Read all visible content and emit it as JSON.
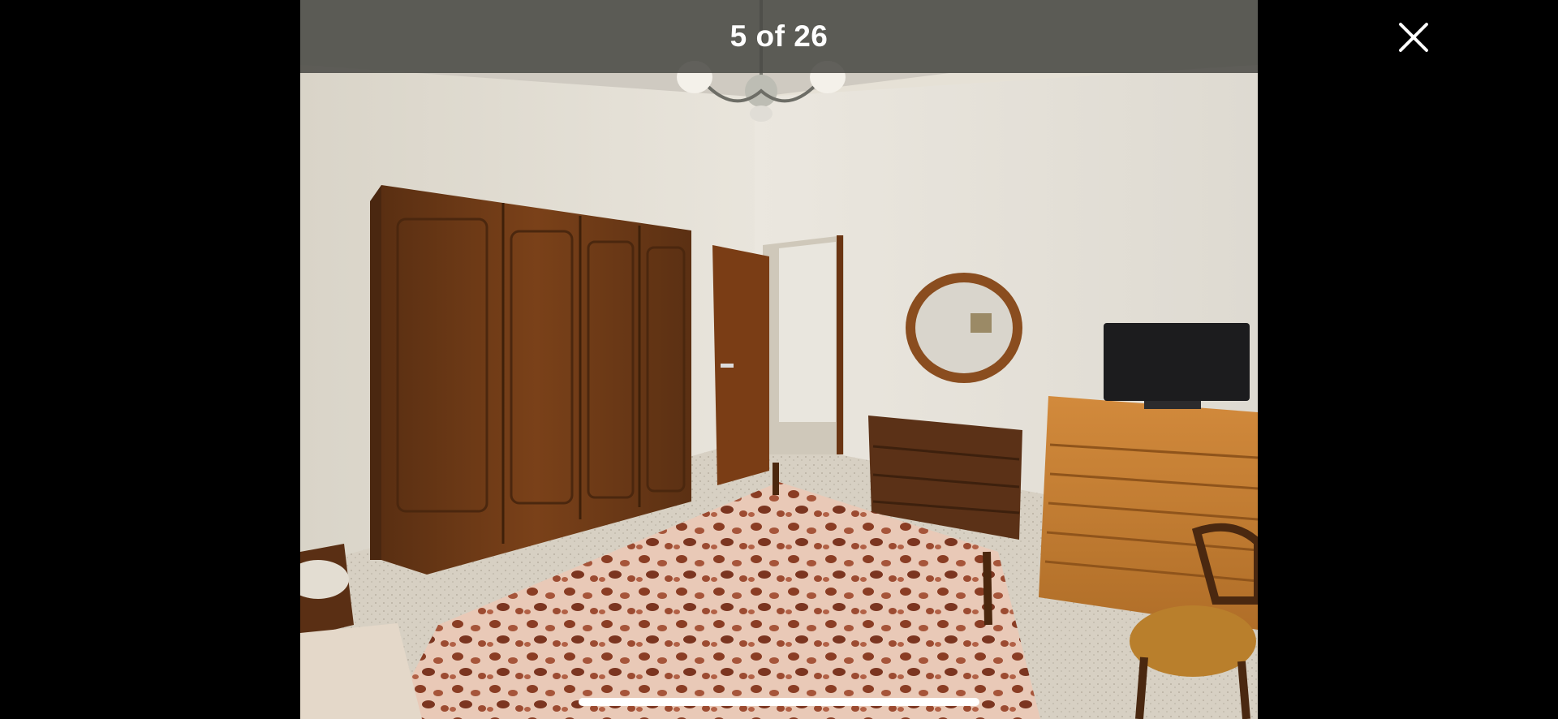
{
  "viewer": {
    "counter_text": "5 of 26",
    "close_icon": "close-icon",
    "current_index": 5,
    "total_count": 26
  },
  "photo": {
    "subject": "bedroom-photo"
  },
  "colors": {
    "background": "#000000",
    "counter_bar": "#484844",
    "counter_text": "#ffffff",
    "close_icon": "#ffffff",
    "scrubber": "#ffffff"
  }
}
